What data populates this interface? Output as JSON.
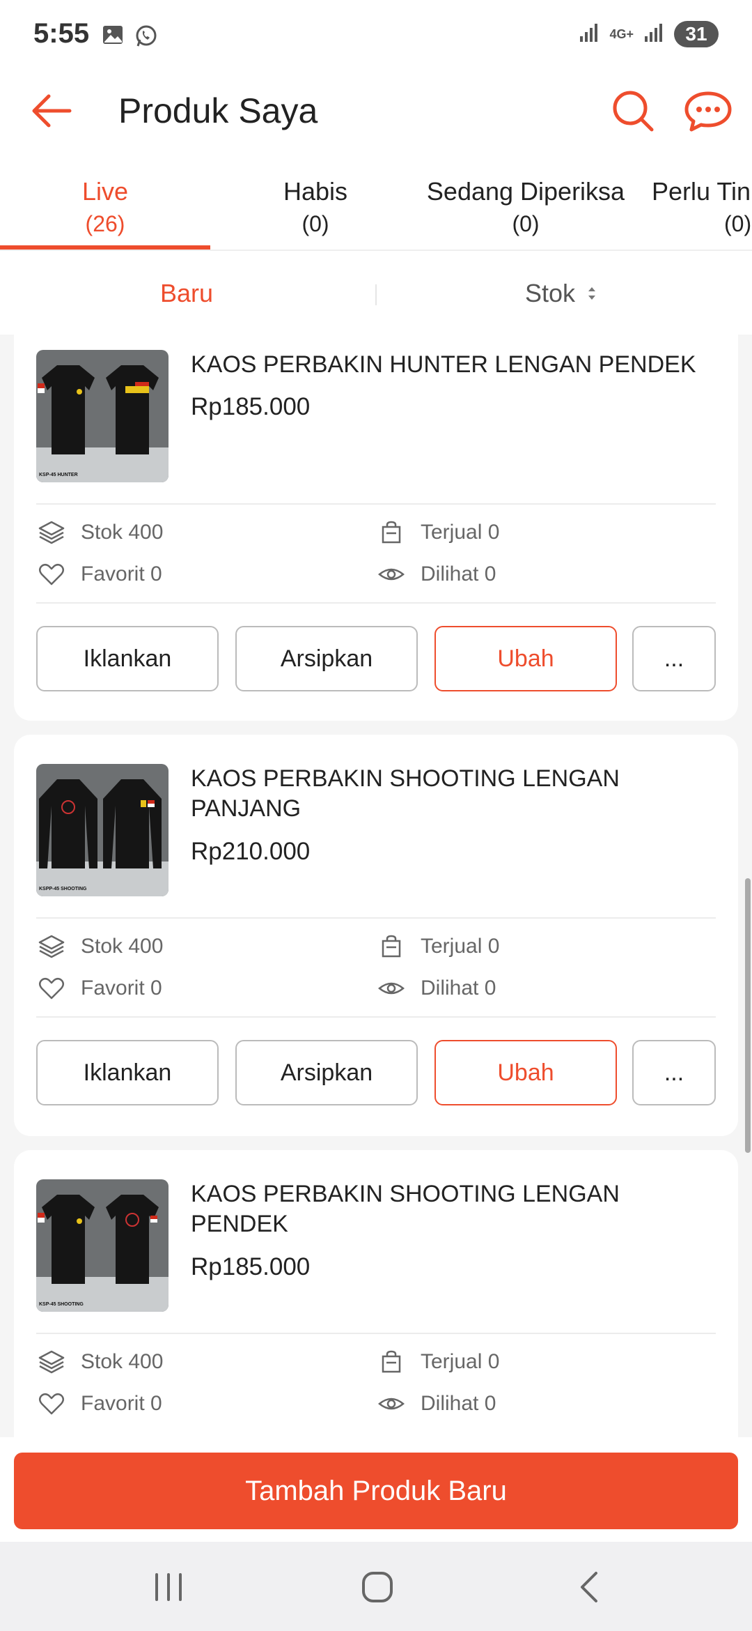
{
  "status_bar": {
    "time": "5:55",
    "network": "4G+",
    "battery": "31"
  },
  "app_bar": {
    "title": "Produk Saya"
  },
  "tabs": [
    {
      "label": "Live",
      "count": "(26)"
    },
    {
      "label": "Habis",
      "count": "(0)"
    },
    {
      "label": "Sedang Diperiksa",
      "count": "(0)"
    },
    {
      "label": "Perlu Tin",
      "count": "(0)"
    }
  ],
  "sort": {
    "new_label": "Baru",
    "stock_label": "Stok"
  },
  "products": [
    {
      "name": "KAOS PERBAKIN HUNTER LENGAN PENDEK",
      "price": "Rp185.000",
      "stock": "Stok 400",
      "sold": "Terjual 0",
      "favorite": "Favorit 0",
      "views": "Dilihat 0",
      "thumb_caption": "KSP-45 HUNTER",
      "actions": [
        "Iklankan",
        "Arsipkan",
        "Ubah",
        "..."
      ]
    },
    {
      "name": "KAOS PERBAKIN SHOOTING LENGAN PANJANG",
      "price": "Rp210.000",
      "stock": "Stok 400",
      "sold": "Terjual 0",
      "favorite": "Favorit 0",
      "views": "Dilihat 0",
      "thumb_caption": "KSPP-45 SHOOTING",
      "actions": [
        "Iklankan",
        "Arsipkan",
        "Ubah",
        "..."
      ]
    },
    {
      "name": "KAOS PERBAKIN SHOOTING LENGAN PENDEK",
      "price": "Rp185.000",
      "stock": "Stok 400",
      "sold": "Terjual 0",
      "favorite": "Favorit 0",
      "views": "Dilihat 0",
      "thumb_caption": "KSP-45 SHOOTING"
    }
  ],
  "bottom": {
    "add_product_label": "Tambah Produk Baru"
  },
  "colors": {
    "accent": "#ee4d2d",
    "text": "#222222",
    "muted": "#666666"
  }
}
